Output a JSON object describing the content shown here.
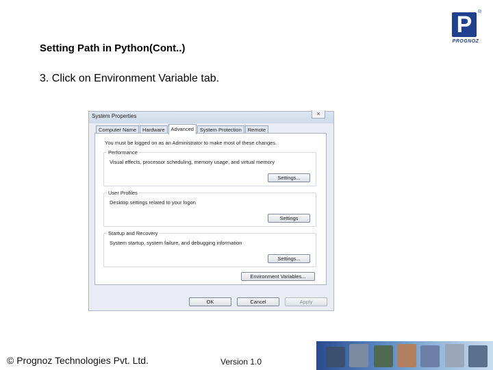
{
  "slide": {
    "title": "Setting Path in Python(Cont..)",
    "step": "3. Click on Environment Variable tab."
  },
  "logo": {
    "text": "PROGNOZ",
    "mark": "P",
    "reg": "®"
  },
  "dialog": {
    "title": "System Properties",
    "close_glyph": "×",
    "tabs": [
      {
        "label": "Computer Name",
        "active": false
      },
      {
        "label": "Hardware",
        "active": false
      },
      {
        "label": "Advanced",
        "active": true
      },
      {
        "label": "System Protection",
        "active": false
      },
      {
        "label": "Remote",
        "active": false
      }
    ],
    "admin_note": "You must be logged on as an Administrator to make most of these changes.",
    "performance": {
      "legend": "Performance",
      "desc": "Visual effects, processor scheduling, memory usage, and virtual memory",
      "button": "Settings..."
    },
    "user_profiles": {
      "legend": "User Profiles",
      "desc": "Desktop settings related to your logon",
      "button": "Settings"
    },
    "startup": {
      "legend": "Startup and Recovery",
      "desc": "System startup, system failure, and debugging information",
      "button": "Settings..."
    },
    "env_button": "Environment Variables...",
    "ok": "OK",
    "cancel": "Cancel",
    "apply": "Apply"
  },
  "footer": {
    "copyright": "© Prognoz Technologies Pvt. Ltd.",
    "version": "Version 1.0"
  },
  "colors": {
    "brand": "#1f3f8f"
  }
}
